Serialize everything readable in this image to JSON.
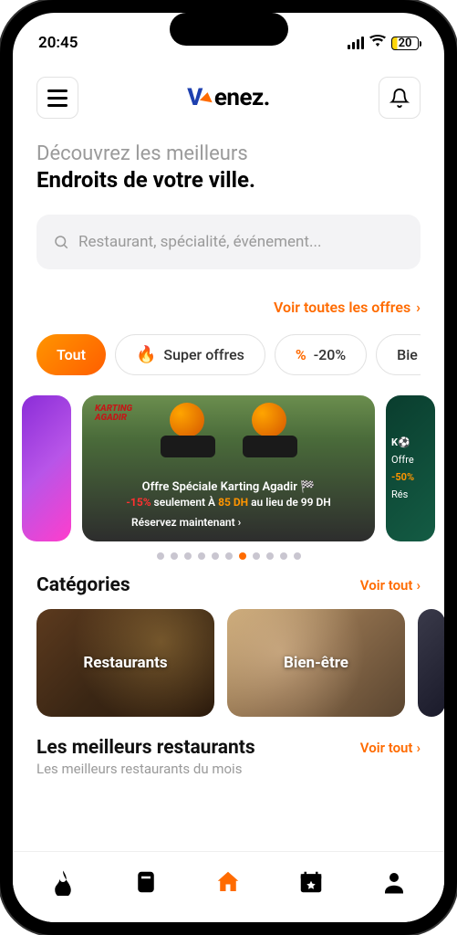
{
  "status": {
    "time": "20:45",
    "battery_pct": "20"
  },
  "header": {
    "brand": "enez."
  },
  "hero": {
    "subtitle": "Découvrez les meilleurs",
    "title": "Endroits de votre ville."
  },
  "search": {
    "placeholder": "Restaurant, spécialité, événement..."
  },
  "offers_link": "Voir toutes les offres",
  "chips": {
    "all": "Tout",
    "super": "Super offres",
    "discount": "-20%",
    "bienetre": "Bie"
  },
  "carousel": {
    "main": {
      "logo_line1": "KARTING",
      "logo_line2": "AGADIR",
      "title": "Offre Spéciale Karting Agadir 🏁",
      "disc1": "-15%",
      "mid1": " seulement À ",
      "price": "85 DH",
      "mid2": " au lieu de 99 DH",
      "cta": "Réservez maintenant ›"
    },
    "right": {
      "logo": "K⚽",
      "offre": "Offre",
      "disc": "-50%",
      "cta": "Rés"
    },
    "dots_total": 11,
    "dots_active": 6
  },
  "categories": {
    "title": "Catégories",
    "see_all": "Voir tout",
    "items": [
      {
        "label": "Restaurants"
      },
      {
        "label": "Bien-être"
      }
    ]
  },
  "best": {
    "title": "Les meilleurs restaurants",
    "subtitle": "Les meilleurs restaurants du mois",
    "see_all": "Voir tout"
  }
}
